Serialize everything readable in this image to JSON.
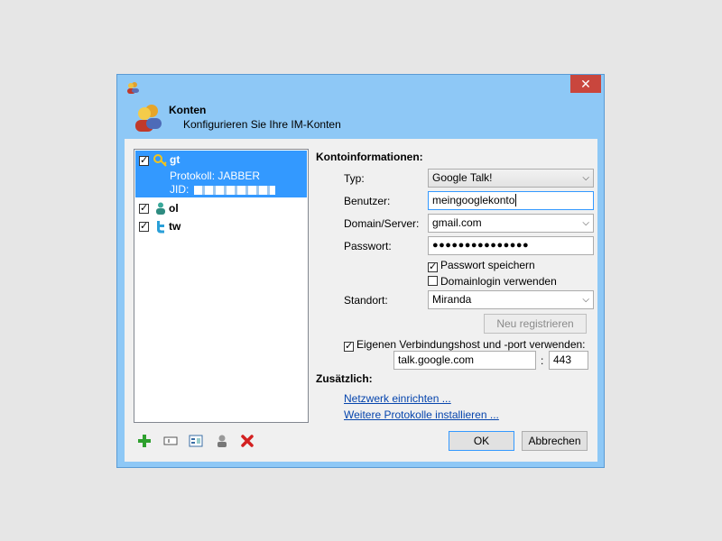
{
  "window": {
    "close_glyph": "✕"
  },
  "header": {
    "title": "Konten",
    "subtitle": "Konfigurieren Sie Ihre IM-Konten"
  },
  "accounts": [
    {
      "name": "gt",
      "checked": true,
      "icon": "key-icon",
      "protocol": "Protokoll: JABBER",
      "jid_label": "JID:"
    },
    {
      "name": "ol",
      "checked": true,
      "icon": "user-icon"
    },
    {
      "name": "tw",
      "checked": true,
      "icon": "twitter-icon"
    }
  ],
  "form": {
    "section_title": "Kontoinformationen:",
    "type_label": "Typ:",
    "type_value": "Google Talk!",
    "user_label": "Benutzer:",
    "user_value": "meingooglekonto",
    "domain_label": "Domain/Server:",
    "domain_value": "gmail.com",
    "password_label": "Passwort:",
    "password_value": "●●●●●●●●●●●●●●●",
    "save_password_label": "Passwort speichern",
    "domain_login_label": "Domainlogin verwenden",
    "location_label": "Standort:",
    "location_value": "Miranda",
    "register_label": "Neu registrieren",
    "custom_host_label": "Eigenen Verbindungshost und -port verwenden:",
    "host_value": "talk.google.com",
    "port_separator": ":",
    "port_value": "443"
  },
  "extra": {
    "section_title": "Zusätzlich:",
    "network_link": "Netzwerk einrichten ...",
    "protocols_link": "Weitere Protokolle installieren ..."
  },
  "buttons": {
    "ok": "OK",
    "cancel": "Abbrechen"
  },
  "colors": {
    "selection": "#3399ff",
    "add": "#2ea02e",
    "delete": "#d32020"
  }
}
